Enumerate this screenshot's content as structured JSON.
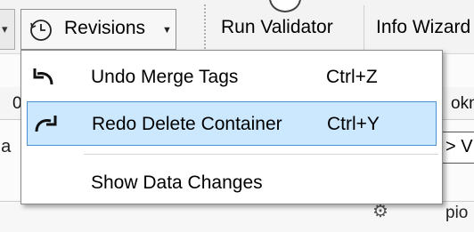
{
  "toolbar": {
    "revisions_label": "Revisions",
    "run_validator_label": "Run Validator",
    "info_wizard_label": "Info Wizard"
  },
  "menu": {
    "items": [
      {
        "label": "Undo Merge Tags",
        "shortcut": "Ctrl+Z",
        "icon": "undo-icon",
        "highlighted": false
      },
      {
        "label": "Redo Delete Container",
        "shortcut": "Ctrl+Y",
        "icon": "redo-icon",
        "highlighted": true
      },
      {
        "label": "Show Data Changes",
        "shortcut": "",
        "icon": "",
        "highlighted": false
      }
    ]
  },
  "background": {
    "row1_left": "0",
    "row1_right": "okm",
    "row2_left": "ga",
    "row2_right": "> V",
    "row3_right": "pio"
  },
  "colors": {
    "highlight_bg": "#cce8ff",
    "highlight_border": "#4a90d0"
  }
}
